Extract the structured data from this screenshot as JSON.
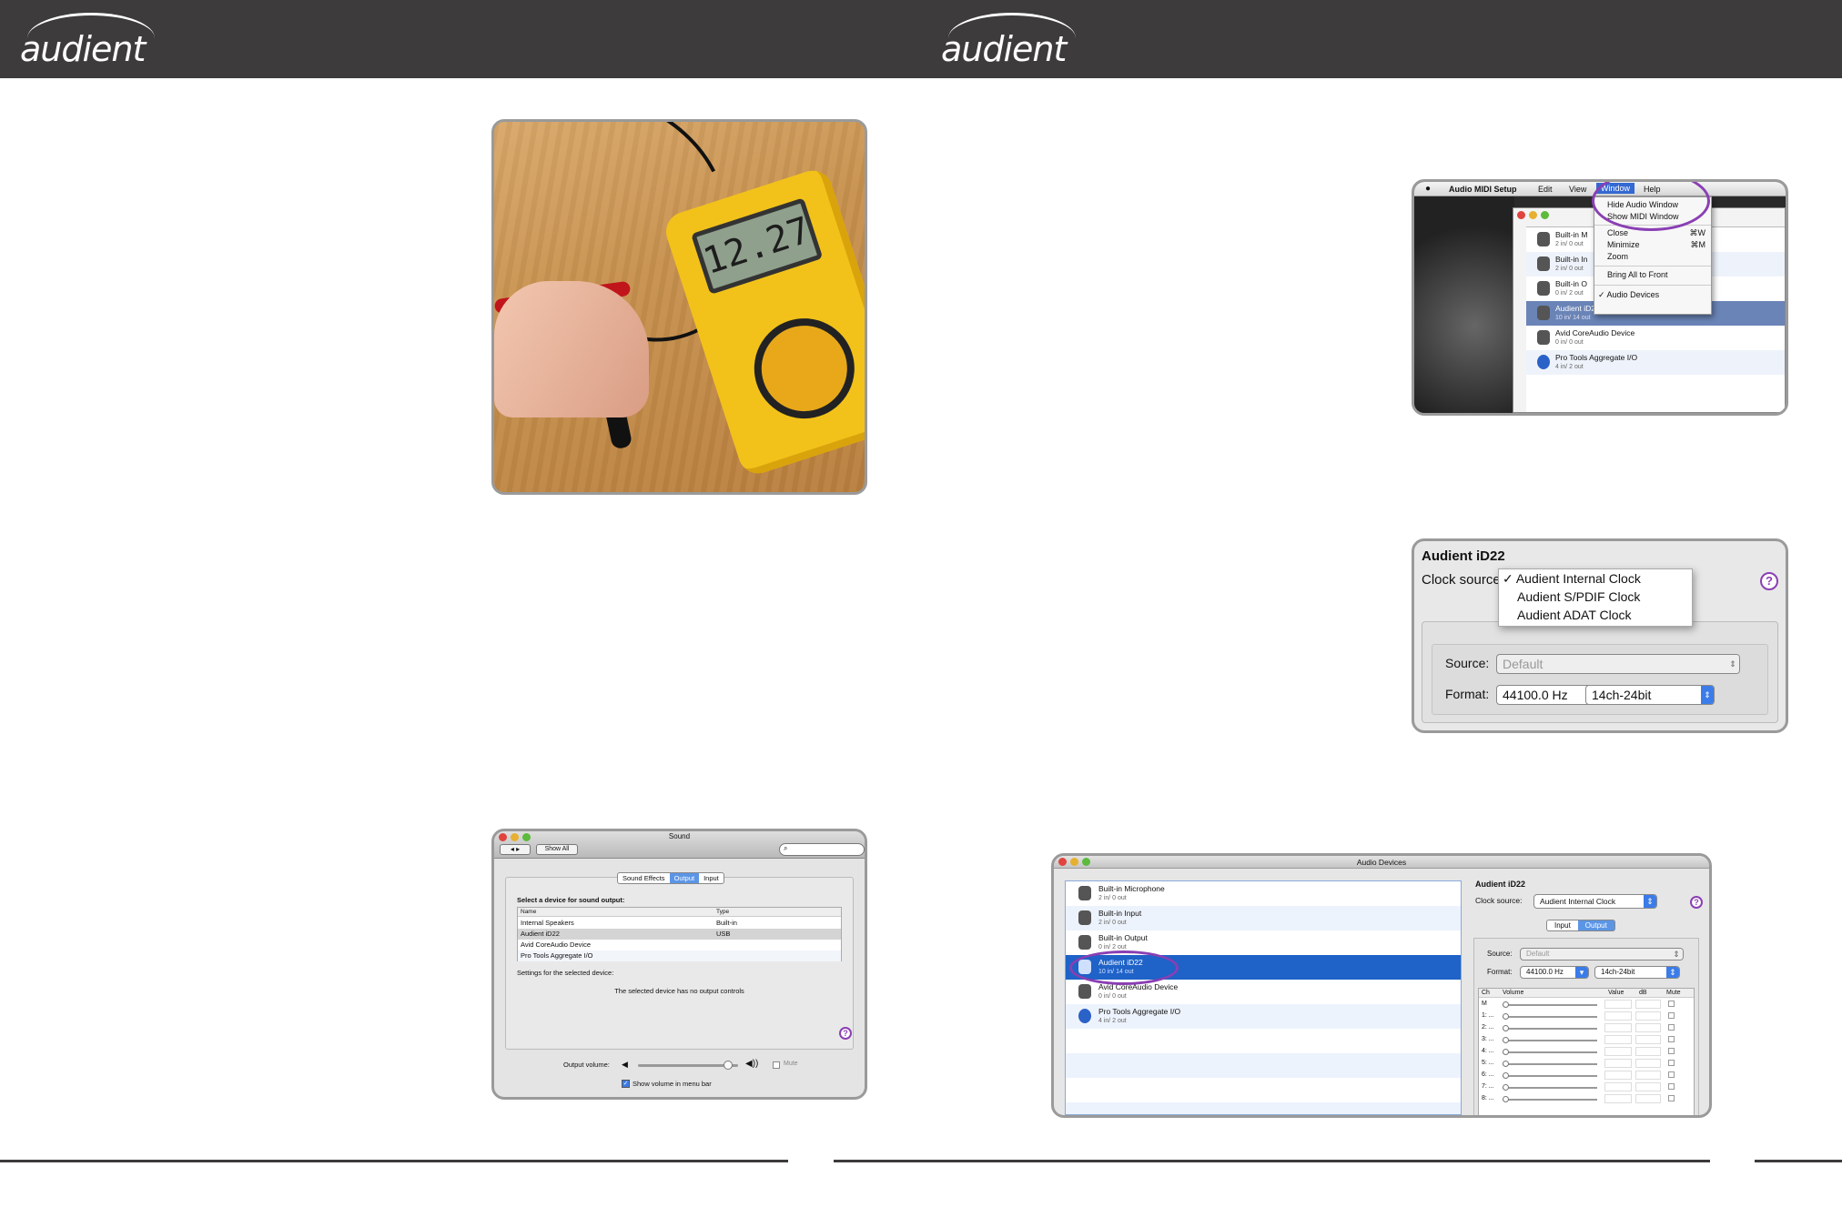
{
  "brand": {
    "logo_text": "audient"
  },
  "photo": {
    "meter_reading": "12.27"
  },
  "midi_window": {
    "menubar": [
      "Audio MIDI Setup",
      "Edit",
      "View",
      "Window",
      "Help"
    ],
    "menu_items": [
      "Hide Audio Window",
      "Show MIDI Window",
      "Close",
      "Minimize",
      "Zoom",
      "Bring All to Front",
      "✓ Audio Devices"
    ],
    "shortcuts": {
      "close": "⌘W",
      "minimize": "⌘M"
    },
    "devices": [
      {
        "name": "Built-in M",
        "sub": "2 in/ 0 out"
      },
      {
        "name": "Built-in In",
        "sub": "2 in/ 0 out"
      },
      {
        "name": "Built-in O",
        "sub": "0 in/ 2 out"
      },
      {
        "name": "Audient iD22",
        "sub": "10 in/ 14 out"
      },
      {
        "name": "Avid CoreAudio Device",
        "sub": "0 in/ 0 out"
      },
      {
        "name": "Pro Tools Aggregate I/O",
        "sub": "4 in/ 2 out"
      }
    ]
  },
  "clock_panel": {
    "title": "Audient iD22",
    "clock_label": "Clock source",
    "options": [
      "✓ Audient Internal Clock",
      "Audient S/PDIF Clock",
      "Audient ADAT Clock"
    ],
    "source_label": "Source:",
    "source_value": "Default",
    "format_label": "Format:",
    "format_rate": "44100.0 Hz",
    "format_bits": "14ch-24bit",
    "help": "?"
  },
  "sound_prefs": {
    "title": "Sound",
    "show_all": "Show All",
    "tabs": [
      "Sound Effects",
      "Output",
      "Input"
    ],
    "select_label": "Select a device for sound output:",
    "columns": [
      "Name",
      "Type"
    ],
    "rows": [
      [
        "Internal Speakers",
        "Built-in"
      ],
      [
        "Audient iD22",
        "USB"
      ],
      [
        "Avid CoreAudio Device",
        ""
      ],
      [
        "Pro Tools Aggregate I/O",
        ""
      ]
    ],
    "settings_label": "Settings for the selected device:",
    "no_controls": "The selected device has no output controls",
    "output_volume_label": "Output volume:",
    "volume_level": 0.85,
    "mute_label": "Mute",
    "show_volume_label": "Show volume in menu bar",
    "help": "?"
  },
  "audio_devices": {
    "title": "Audio Devices",
    "devices": [
      {
        "name": "Built-in Microphone",
        "sub": "2 in/ 0 out"
      },
      {
        "name": "Built-in Input",
        "sub": "2 in/ 0 out"
      },
      {
        "name": "Built-in Output",
        "sub": "0 in/ 2 out"
      },
      {
        "name": "Audient iD22",
        "sub": "10 in/ 14 out"
      },
      {
        "name": "Avid CoreAudio Device",
        "sub": "0 in/ 0 out"
      },
      {
        "name": "Pro Tools Aggregate I/O",
        "sub": "4 in/ 2 out"
      }
    ],
    "detail_title": "Audient iD22",
    "clock_label": "Clock source:",
    "clock_value": "Audient Internal Clock",
    "tabs": [
      "Input",
      "Output"
    ],
    "source_label": "Source:",
    "source_value": "Default",
    "format_label": "Format:",
    "format_rate": "44100.0 Hz",
    "format_bits": "14ch-24bit",
    "columns": [
      "Ch",
      "Volume",
      "Value",
      "dB",
      "Mute"
    ],
    "channels": [
      "M",
      "1: ...",
      "2: ...",
      "3: ...",
      "4: ...",
      "5: ...",
      "6: ...",
      "7: ...",
      "8: ..."
    ],
    "help": "?"
  }
}
